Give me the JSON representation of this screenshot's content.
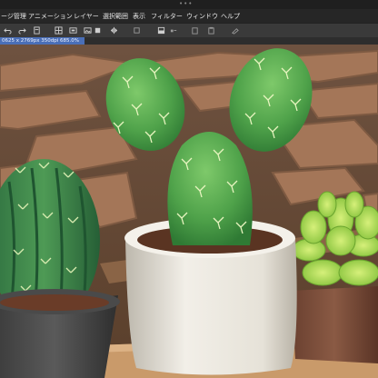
{
  "window": {
    "more_indicator": "•••"
  },
  "menubar": {
    "items": [
      {
        "label": "ージ管理"
      },
      {
        "label": "アニメーション"
      },
      {
        "label": "レイヤー"
      },
      {
        "label": "選択範囲"
      },
      {
        "label": "表示"
      },
      {
        "label": "フィルター"
      },
      {
        "label": "ウィンドウ"
      },
      {
        "label": "ヘルプ"
      }
    ]
  },
  "toolbar": {
    "icons": [
      "undo-icon",
      "redo-icon",
      "file-icon",
      "grid-icon",
      "layer-icon",
      "image-icon",
      "fill-icon",
      "flip-icon",
      "transform-icon",
      "layer-stack-icon",
      "copy-icon",
      "paste-icon",
      "eraser-icon"
    ]
  },
  "document": {
    "tab_label": "0625 x 2769px 350dpi 685.0%"
  },
  "colors": {
    "menubar_bg": "#262626",
    "toolbar_bg": "#3a3a3a",
    "tab_accent": "#4a6fb8"
  }
}
